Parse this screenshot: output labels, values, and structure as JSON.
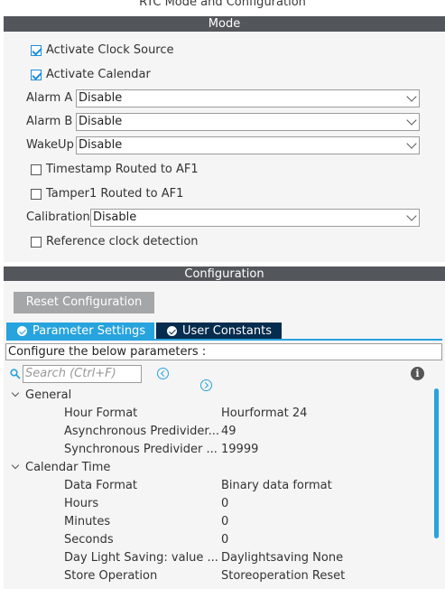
{
  "header": {
    "title": "RTC Mode and Configuration"
  },
  "mode": {
    "section_title": "Mode",
    "activate_clock_source": {
      "label": "Activate Clock Source",
      "checked": true
    },
    "activate_calendar": {
      "label": "Activate Calendar",
      "checked": true
    },
    "alarm_a": {
      "label": "Alarm A",
      "value": "Disable"
    },
    "alarm_b": {
      "label": "Alarm B",
      "value": "Disable"
    },
    "wakeup": {
      "label": "WakeUp",
      "value": "Disable"
    },
    "timestamp": {
      "label": "Timestamp Routed to AF1",
      "checked": false
    },
    "tamper1": {
      "label": "Tamper1 Routed to AF1",
      "checked": false
    },
    "calibration": {
      "label": "Calibration",
      "value": "Disable"
    },
    "reference_clock": {
      "label": "Reference clock detection",
      "checked": false
    }
  },
  "configuration": {
    "section_title": "Configuration",
    "reset_label": "Reset Configuration",
    "tabs": [
      {
        "label": "Parameter Settings",
        "active": true
      },
      {
        "label": "User Constants",
        "active": false
      }
    ],
    "description": "Configure the below parameters :",
    "search_placeholder": "Search (Ctrl+F)",
    "groups": [
      {
        "name": "General",
        "params": [
          {
            "name": "Hour Format",
            "value": "Hourformat 24"
          },
          {
            "name": "Asynchronous Predivider...",
            "value": "49"
          },
          {
            "name": "Synchronous Predivider ...",
            "value": "19999"
          }
        ]
      },
      {
        "name": "Calendar Time",
        "params": [
          {
            "name": "Data Format",
            "value": "Binary data format"
          },
          {
            "name": "Hours",
            "value": "0"
          },
          {
            "name": "Minutes",
            "value": "0"
          },
          {
            "name": "Seconds",
            "value": "0"
          },
          {
            "name": "Day Light Saving: value ...",
            "value": "Daylightsaving None"
          },
          {
            "name": "Store Operation",
            "value": "Storeoperation Reset"
          }
        ]
      }
    ]
  },
  "colors": {
    "accent": "#27a3de",
    "dark_tab": "#062c4e",
    "section_bar": "#53575b"
  },
  "icons": [
    "check-icon",
    "chevron-down-icon",
    "search-icon",
    "arrow-left-icon",
    "arrow-right-icon",
    "info-icon",
    "caret-down-icon"
  ]
}
